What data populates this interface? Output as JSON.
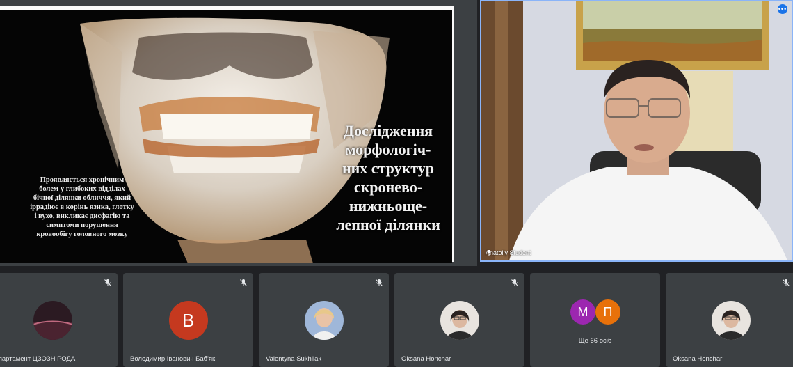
{
  "slide": {
    "title_lines": [
      "Дослідження",
      "морфологіч-",
      "них структур",
      "скроневo-",
      "нижньоще-",
      "лепної ділянки"
    ],
    "text_lines": [
      "Проявляється хронічним",
      "болем у глибоких відділах",
      "бічної ділянки обличчя, який",
      "іррадіює в корінь язика, глотку",
      "і вухо, викликає дисфагію та",
      "симптоми порушення",
      "кровообігу головного мозку"
    ]
  },
  "speaker": {
    "name": "Anatoliy Student",
    "pin_icon": "pin-icon",
    "more_icon": "more-options-icon"
  },
  "participants": [
    {
      "name": "Департамент ЦЗОЗН РОДА",
      "avatar_type": "photo"
    },
    {
      "name": "Володимир Іванович Баб'як",
      "avatar_type": "letter",
      "letter": "В",
      "color": "#c5391f"
    },
    {
      "name": "Valentyna Sukhliak",
      "avatar_type": "photo"
    },
    {
      "name": "Oksana Honchar",
      "avatar_type": "photo"
    },
    {
      "name": "",
      "avatar_type": "group",
      "more_label": "Ще 66 осіб",
      "letters": [
        "М",
        "П"
      ],
      "colors": [
        "#9c27b0",
        "#e8710a"
      ]
    },
    {
      "name": "Oksana Honchar",
      "avatar_type": "photo"
    }
  ],
  "icons": {
    "mic_off": "mic-off-icon"
  }
}
